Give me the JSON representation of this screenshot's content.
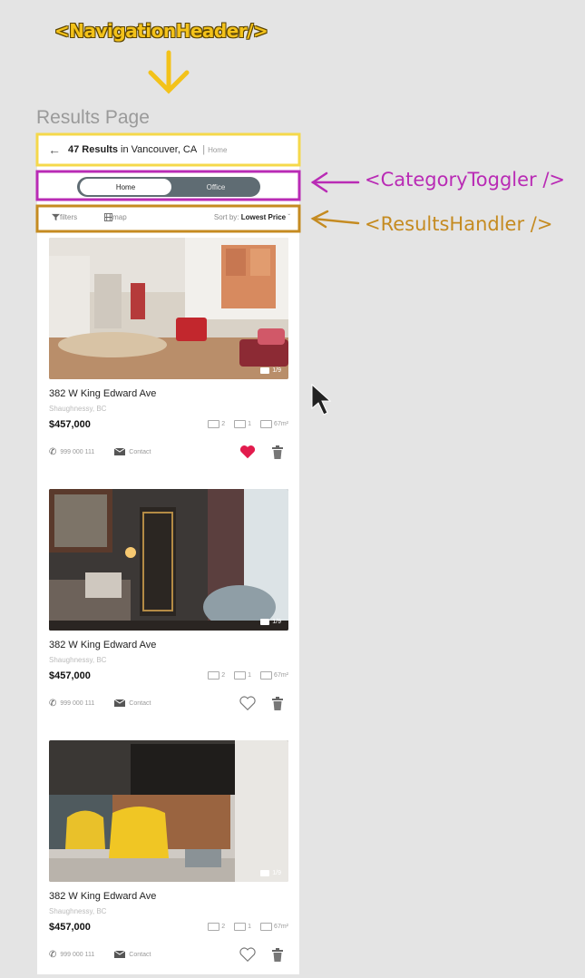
{
  "annotations": {
    "navigation_header": "<NavigationHeader/>",
    "category_toggler": "<CategoryToggler />",
    "results_handler": "<ResultsHandler />",
    "page_caption": "Results Page",
    "colors": {
      "nav": "#f3c21a",
      "toggler": "#b92bb5",
      "results": "#c58b21"
    }
  },
  "header": {
    "back_icon": "arrow-left-icon",
    "count": "47 Results",
    "location": "in Vancouver, CA",
    "separator": "|",
    "category": "Home"
  },
  "toggler": {
    "options": [
      "Home",
      "Office"
    ],
    "selected": "Home"
  },
  "results_bar": {
    "filters_label": "filters",
    "map_label": "map",
    "sort_prefix": "Sort by:",
    "sort_value": "Lowest Price"
  },
  "listings": [
    {
      "address": "382 W King Edward Ave",
      "area": "Shaughnessy, BC",
      "price": "$457,000",
      "beds": "2",
      "baths": "1",
      "size": "67m²",
      "phone": "999 000 111",
      "contact_label": "Contact",
      "photo_count": "1/9",
      "favorited": true
    },
    {
      "address": "382 W King Edward Ave",
      "area": "Shaughnessy, BC",
      "price": "$457,000",
      "beds": "2",
      "baths": "1",
      "size": "67m²",
      "phone": "999 000 111",
      "contact_label": "Contact",
      "photo_count": "1/9",
      "favorited": false
    },
    {
      "address": "382 W King Edward Ave",
      "area": "Shaughnessy, BC",
      "price": "$457,000",
      "beds": "2",
      "baths": "1",
      "size": "67m²",
      "phone": "999 000 111",
      "contact_label": "Contact",
      "photo_count": "1/9",
      "favorited": false
    }
  ]
}
